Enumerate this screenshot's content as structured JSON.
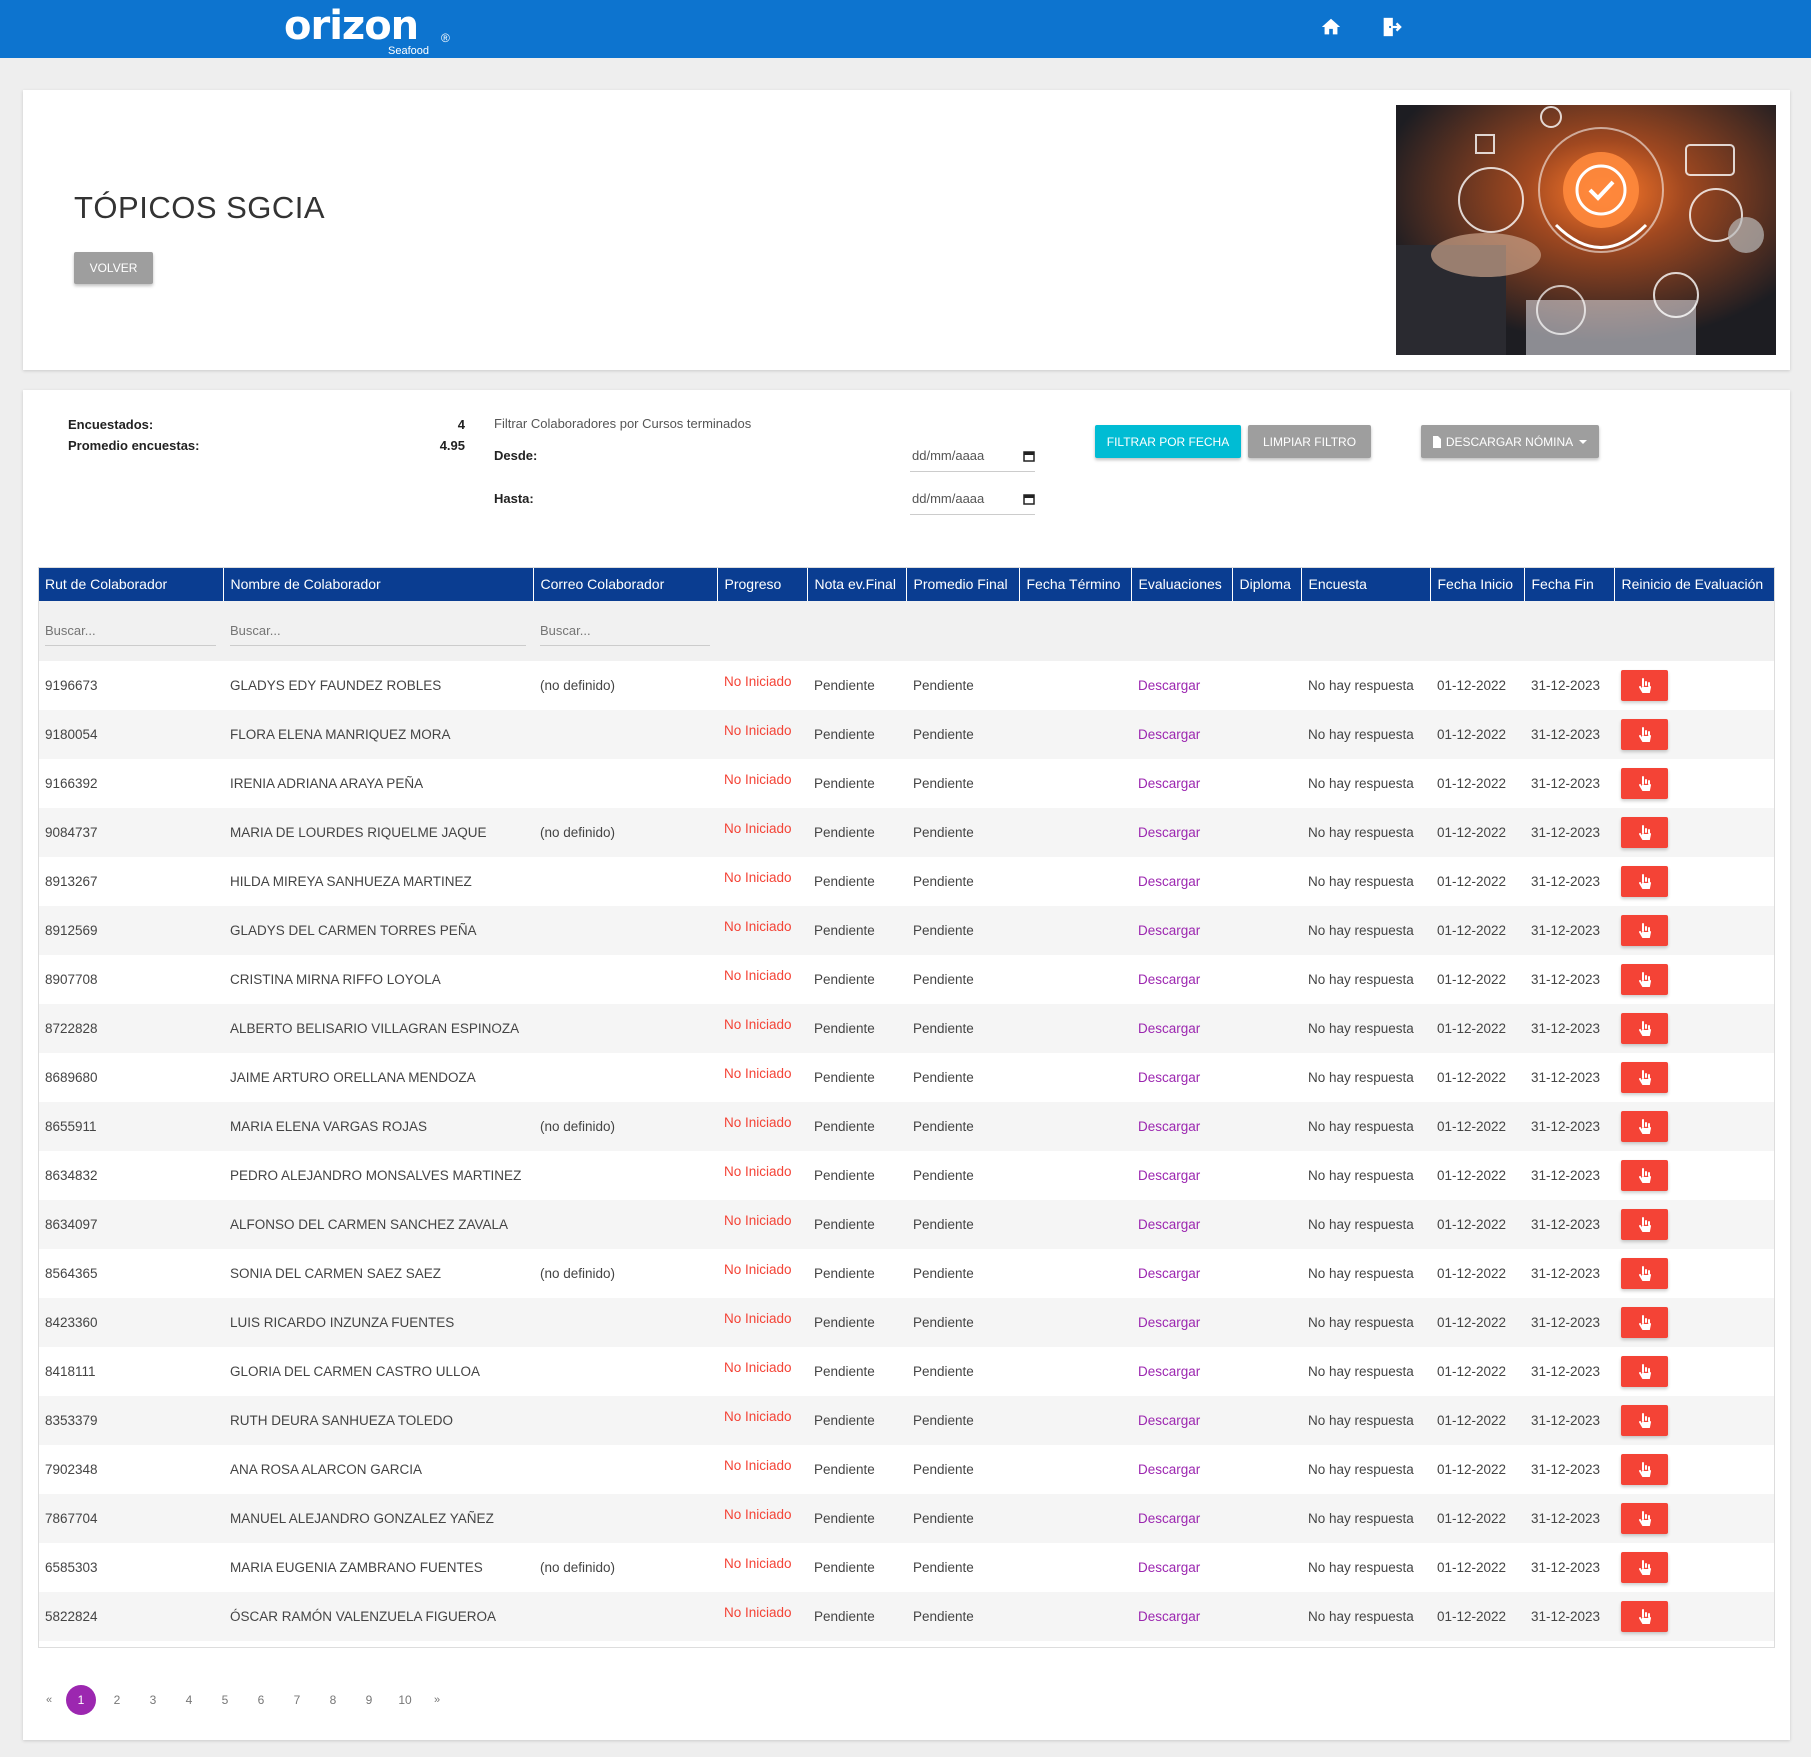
{
  "header": {
    "logo": "orizon",
    "logo_sub": "Seafood",
    "logo_reg": "®",
    "nav_icons": [
      "home-icon",
      "logout-icon"
    ]
  },
  "course": {
    "title": "TÓPICOS SGCIA",
    "back_label": "VOLVER"
  },
  "stats": {
    "surveyed_label": "Encuestados:",
    "surveyed_value": "4",
    "avg_label": "Promedio encuestas:",
    "avg_value": "4.95"
  },
  "filter": {
    "title": "Filtrar Colaboradores por Cursos terminados",
    "from_label": "Desde:",
    "to_label": "Hasta:",
    "from_placeholder": "dd/mm/aaaa",
    "to_placeholder": "dd/mm/aaaa",
    "filter_button": "FILTRAR POR FECHA",
    "clear_button": "LIMPIAR FILTRO",
    "download_button": "DESCARGAR NÓMINA"
  },
  "table": {
    "columns": [
      "Rut de Colaborador",
      "Nombre de Colaborador",
      "Correo Colaborador",
      "Progreso",
      "Nota ev.Final",
      "Promedio Final",
      "Fecha Término",
      "Evaluaciones",
      "Diploma",
      "Encuesta",
      "Fecha Inicio",
      "Fecha Fin",
      "Reinicio de Evaluación"
    ],
    "search_placeholder": "Buscar...",
    "rows": [
      {
        "rut": "9196673",
        "name": "GLADYS EDY FAUNDEZ ROBLES",
        "email": "(no definido)",
        "progress": "No Iniciado",
        "grade": "Pendiente",
        "avg": "Pendiente",
        "end_date": "",
        "evals": "Descargar",
        "diploma": "",
        "survey": "No hay respuesta",
        "start": "01-12-2022",
        "finish": "31-12-2023"
      },
      {
        "rut": "9180054",
        "name": "FLORA ELENA MANRIQUEZ MORA",
        "email": "",
        "progress": "No Iniciado",
        "grade": "Pendiente",
        "avg": "Pendiente",
        "end_date": "",
        "evals": "Descargar",
        "diploma": "",
        "survey": "No hay respuesta",
        "start": "01-12-2022",
        "finish": "31-12-2023"
      },
      {
        "rut": "9166392",
        "name": "IRENIA ADRIANA ARAYA PEÑA",
        "email": "",
        "progress": "No Iniciado",
        "grade": "Pendiente",
        "avg": "Pendiente",
        "end_date": "",
        "evals": "Descargar",
        "diploma": "",
        "survey": "No hay respuesta",
        "start": "01-12-2022",
        "finish": "31-12-2023"
      },
      {
        "rut": "9084737",
        "name": "MARIA DE LOURDES RIQUELME JAQUE",
        "email": "(no definido)",
        "progress": "No Iniciado",
        "grade": "Pendiente",
        "avg": "Pendiente",
        "end_date": "",
        "evals": "Descargar",
        "diploma": "",
        "survey": "No hay respuesta",
        "start": "01-12-2022",
        "finish": "31-12-2023"
      },
      {
        "rut": "8913267",
        "name": "HILDA MIREYA SANHUEZA MARTINEZ",
        "email": "",
        "progress": "No Iniciado",
        "grade": "Pendiente",
        "avg": "Pendiente",
        "end_date": "",
        "evals": "Descargar",
        "diploma": "",
        "survey": "No hay respuesta",
        "start": "01-12-2022",
        "finish": "31-12-2023"
      },
      {
        "rut": "8912569",
        "name": "GLADYS DEL CARMEN TORRES PEÑA",
        "email": "",
        "progress": "No Iniciado",
        "grade": "Pendiente",
        "avg": "Pendiente",
        "end_date": "",
        "evals": "Descargar",
        "diploma": "",
        "survey": "No hay respuesta",
        "start": "01-12-2022",
        "finish": "31-12-2023"
      },
      {
        "rut": "8907708",
        "name": "CRISTINA MIRNA RIFFO LOYOLA",
        "email": "",
        "progress": "No Iniciado",
        "grade": "Pendiente",
        "avg": "Pendiente",
        "end_date": "",
        "evals": "Descargar",
        "diploma": "",
        "survey": "No hay respuesta",
        "start": "01-12-2022",
        "finish": "31-12-2023"
      },
      {
        "rut": "8722828",
        "name": "ALBERTO BELISARIO VILLAGRAN ESPINOZA",
        "email": "",
        "progress": "No Iniciado",
        "grade": "Pendiente",
        "avg": "Pendiente",
        "end_date": "",
        "evals": "Descargar",
        "diploma": "",
        "survey": "No hay respuesta",
        "start": "01-12-2022",
        "finish": "31-12-2023"
      },
      {
        "rut": "8689680",
        "name": "JAIME ARTURO ORELLANA MENDOZA",
        "email": "",
        "progress": "No Iniciado",
        "grade": "Pendiente",
        "avg": "Pendiente",
        "end_date": "",
        "evals": "Descargar",
        "diploma": "",
        "survey": "No hay respuesta",
        "start": "01-12-2022",
        "finish": "31-12-2023"
      },
      {
        "rut": "8655911",
        "name": "MARIA ELENA VARGAS ROJAS",
        "email": "(no definido)",
        "progress": "No Iniciado",
        "grade": "Pendiente",
        "avg": "Pendiente",
        "end_date": "",
        "evals": "Descargar",
        "diploma": "",
        "survey": "No hay respuesta",
        "start": "01-12-2022",
        "finish": "31-12-2023"
      },
      {
        "rut": "8634832",
        "name": "PEDRO ALEJANDRO MONSALVES MARTINEZ",
        "email": "",
        "progress": "No Iniciado",
        "grade": "Pendiente",
        "avg": "Pendiente",
        "end_date": "",
        "evals": "Descargar",
        "diploma": "",
        "survey": "No hay respuesta",
        "start": "01-12-2022",
        "finish": "31-12-2023"
      },
      {
        "rut": "8634097",
        "name": "ALFONSO DEL CARMEN SANCHEZ ZAVALA",
        "email": "",
        "progress": "No Iniciado",
        "grade": "Pendiente",
        "avg": "Pendiente",
        "end_date": "",
        "evals": "Descargar",
        "diploma": "",
        "survey": "No hay respuesta",
        "start": "01-12-2022",
        "finish": "31-12-2023"
      },
      {
        "rut": "8564365",
        "name": "SONIA DEL CARMEN SAEZ SAEZ",
        "email": "(no definido)",
        "progress": "No Iniciado",
        "grade": "Pendiente",
        "avg": "Pendiente",
        "end_date": "",
        "evals": "Descargar",
        "diploma": "",
        "survey": "No hay respuesta",
        "start": "01-12-2022",
        "finish": "31-12-2023"
      },
      {
        "rut": "8423360",
        "name": "LUIS RICARDO INZUNZA FUENTES",
        "email": "",
        "progress": "No Iniciado",
        "grade": "Pendiente",
        "avg": "Pendiente",
        "end_date": "",
        "evals": "Descargar",
        "diploma": "",
        "survey": "No hay respuesta",
        "start": "01-12-2022",
        "finish": "31-12-2023"
      },
      {
        "rut": "8418111",
        "name": "GLORIA DEL CARMEN CASTRO ULLOA",
        "email": "",
        "progress": "No Iniciado",
        "grade": "Pendiente",
        "avg": "Pendiente",
        "end_date": "",
        "evals": "Descargar",
        "diploma": "",
        "survey": "No hay respuesta",
        "start": "01-12-2022",
        "finish": "31-12-2023"
      },
      {
        "rut": "8353379",
        "name": "RUTH DEURA SANHUEZA TOLEDO",
        "email": "",
        "progress": "No Iniciado",
        "grade": "Pendiente",
        "avg": "Pendiente",
        "end_date": "",
        "evals": "Descargar",
        "diploma": "",
        "survey": "No hay respuesta",
        "start": "01-12-2022",
        "finish": "31-12-2023"
      },
      {
        "rut": "7902348",
        "name": "ANA ROSA ALARCON GARCIA",
        "email": "",
        "progress": "No Iniciado",
        "grade": "Pendiente",
        "avg": "Pendiente",
        "end_date": "",
        "evals": "Descargar",
        "diploma": "",
        "survey": "No hay respuesta",
        "start": "01-12-2022",
        "finish": "31-12-2023"
      },
      {
        "rut": "7867704",
        "name": "MANUEL ALEJANDRO GONZALEZ YAÑEZ",
        "email": "",
        "progress": "No Iniciado",
        "grade": "Pendiente",
        "avg": "Pendiente",
        "end_date": "",
        "evals": "Descargar",
        "diploma": "",
        "survey": "No hay respuesta",
        "start": "01-12-2022",
        "finish": "31-12-2023"
      },
      {
        "rut": "6585303",
        "name": "MARIA EUGENIA ZAMBRANO FUENTES",
        "email": "(no definido)",
        "progress": "No Iniciado",
        "grade": "Pendiente",
        "avg": "Pendiente",
        "end_date": "",
        "evals": "Descargar",
        "diploma": "",
        "survey": "No hay respuesta",
        "start": "01-12-2022",
        "finish": "31-12-2023"
      },
      {
        "rut": "5822824",
        "name": "ÓSCAR RAMÓN VALENZUELA FIGUEROA",
        "email": "",
        "progress": "No Iniciado",
        "grade": "Pendiente",
        "avg": "Pendiente",
        "end_date": "",
        "evals": "Descargar",
        "diploma": "",
        "survey": "No hay respuesta",
        "start": "01-12-2022",
        "finish": "31-12-2023"
      }
    ]
  },
  "pagination": {
    "prev": "«",
    "next": "»",
    "pages": [
      "1",
      "2",
      "3",
      "4",
      "5",
      "6",
      "7",
      "8",
      "9",
      "10"
    ],
    "current": "1"
  },
  "colors": {
    "topbar": "#0d74cf",
    "table_header": "#0a3d91",
    "status_red": "#f44336",
    "link_purple": "#9c27b0",
    "filter_cyan": "#00bcd4"
  }
}
